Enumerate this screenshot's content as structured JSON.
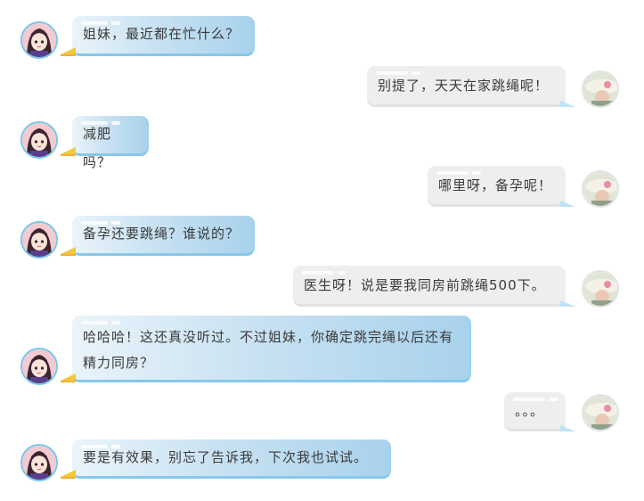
{
  "messages": [
    {
      "side": "left",
      "text": "姐妹，最近都在忙什么？"
    },
    {
      "side": "right",
      "text": "别提了，天天在家跳绳呢！"
    },
    {
      "side": "left",
      "text": "减肥吗？"
    },
    {
      "side": "right",
      "text": "哪里呀，备孕呢！"
    },
    {
      "side": "left",
      "text": "备孕还要跳绳？谁说的？"
    },
    {
      "side": "right",
      "text": "医生呀！说是要我同房前跳绳500下。"
    },
    {
      "side": "left",
      "text": "哈哈哈！这还真没听过。不过姐妹，你确定跳完绳以后还有精力同房？"
    },
    {
      "side": "right",
      "text": "。。。"
    },
    {
      "side": "left",
      "text": "要是有效果，别忘了告诉我，下次我也试试。"
    }
  ]
}
